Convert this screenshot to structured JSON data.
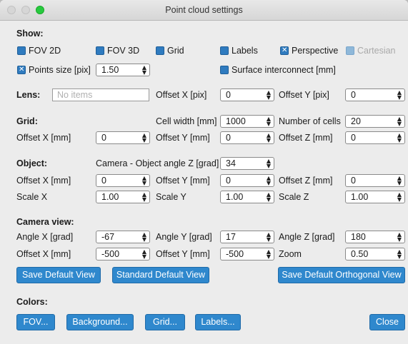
{
  "window": {
    "title": "Point cloud settings"
  },
  "show": {
    "heading": "Show:",
    "fov2d": {
      "label": "FOV 2D",
      "checked": false
    },
    "fov3d": {
      "label": "FOV 3D",
      "checked": false
    },
    "grid": {
      "label": "Grid",
      "checked": false
    },
    "labels": {
      "label": "Labels",
      "checked": false
    },
    "perspective": {
      "label": "Perspective",
      "checked": true
    },
    "cartesian": {
      "label": "Cartesian",
      "checked": false,
      "disabled": true
    },
    "points_size": {
      "label": "Points size [pix]",
      "checked": true,
      "value": "1.50"
    },
    "surface": {
      "label": "Surface interconnect [mm]",
      "checked": false
    }
  },
  "lens": {
    "heading": "Lens:",
    "placeholder": "No items",
    "offset_x_label": "Offset X [pix]",
    "offset_x": "0",
    "offset_y_label": "Offset Y [pix]",
    "offset_y": "0"
  },
  "grid": {
    "heading": "Grid:",
    "cell_width_label": "Cell width [mm]",
    "cell_width": "1000",
    "num_cells_label": "Number of cells",
    "num_cells": "20",
    "offset_x_label": "Offset X [mm]",
    "offset_x": "0",
    "offset_y_label": "Offset Y [mm]",
    "offset_y": "0",
    "offset_z_label": "Offset Z [mm]",
    "offset_z": "0"
  },
  "object": {
    "heading": "Object:",
    "angle_label": "Camera - Object angle Z [grad]",
    "angle": "34",
    "offset_x_label": "Offset X [mm]",
    "offset_x": "0",
    "offset_y_label": "Offset Y [mm]",
    "offset_y": "0",
    "offset_z_label": "Offset Z [mm]",
    "offset_z": "0",
    "scale_x_label": "Scale X",
    "scale_x": "1.00",
    "scale_y_label": "Scale Y",
    "scale_y": "1.00",
    "scale_z_label": "Scale Z",
    "scale_z": "1.00"
  },
  "camera": {
    "heading": "Camera view:",
    "angle_x_label": "Angle  X [grad]",
    "angle_x": "-67",
    "angle_y_label": "Angle Y [grad]",
    "angle_y": "17",
    "angle_z_label": "Angle Z [grad]",
    "angle_z": "180",
    "offset_x_label": "Offset X [mm]",
    "offset_x": "-500",
    "offset_y_label": "Offset Y [mm]",
    "offset_y": "-500",
    "zoom_label": "Zoom",
    "zoom": "0.50",
    "save_default": "Save Default View",
    "standard_default": "Standard Default View",
    "save_orthogonal": "Save Default Orthogonal View"
  },
  "colors": {
    "heading": "Colors:",
    "fov": "FOV...",
    "background": "Background...",
    "grid": "Grid...",
    "labels": "Labels...",
    "close": "Close"
  },
  "theme": {
    "accent": "#2f88cd",
    "window_bg": "#ececec"
  },
  "spin_arrows": "▲▼"
}
